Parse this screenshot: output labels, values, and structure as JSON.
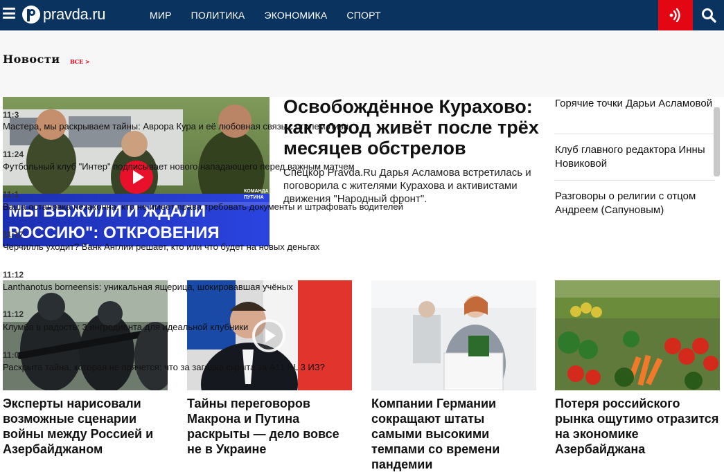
{
  "header": {
    "logo_text": "pravda.ru",
    "nav": [
      "МИР",
      "ПОЛИТИКА",
      "ЭКОНОМИКА",
      "СПОРТ"
    ],
    "colors": {
      "bar": "#0b3360",
      "accent": "#e30613"
    }
  },
  "news_section": {
    "title": "Новости",
    "all_link": "ВСЕ >"
  },
  "feature": {
    "image_caption": "МЫ ВЫЖИЛИ И ЖДАЛИ РОССИЮ\": ОТКРОВЕНИЯ ЖИТЕЛЕЙ КУРАХОВО",
    "image_badge": "КОМАНДА ПУТИНА",
    "title": "Освобождённое Курахово: как город живёт после трёх месяцев обстрелов",
    "lead": "Спецкор Pravda.Ru Дарья Асламова встретилась и поговорила с жителями Курахова и активистами движения \"Народный фронт\"."
  },
  "right_list": [
    "Горячие точки Дарьи Асламовой",
    "Клуб главного редактора Инны Новиковой",
    "Разговоры о религии с отцом Андреем (Сапуновым)"
  ],
  "feed": [
    {
      "time": "11:3",
      "text": "Мастера, мы раскрываем тайны: Аврора Кура и её любовная связь с стилем Ливи"
    },
    {
      "time": "11:24",
      "text": "Футбольный клуб \"Интер\" подписывает нового нападающего перед важным матчем"
    },
    {
      "time": "11:1",
      "text": "Ваша остановка незаконна, кто не имеет права требовать документы и штрафовать водителей"
    },
    {
      "time": "11:17",
      "text": "Черчилль уходит? Банк Англии решает, кто или что будет на новых деньгах"
    },
    {
      "time": "11:12",
      "text": "Lanthanotus borneensis: уникальная ящерица, шокировавшая учёных"
    },
    {
      "time": "11:12",
      "text": "Клумба в радость: 3 ингредиента для идеальной клубники"
    },
    {
      "time": "11:0",
      "text": "Раскрыта тайна, которая не прячется: что за загадка скрыта за A11 PL 3 ИЗ?"
    }
  ],
  "cards": [
    {
      "title": "Эксперты нарисовали возможные сценарии войны между Россией и Азербайджаном"
    },
    {
      "title": "Тайны переговоров Макрона и Путина раскрыты — дело вовсе не в Украине"
    },
    {
      "title": "Компании Германии сокращают штаты самыми высокими темпами со времени пандемии"
    },
    {
      "title": "Потеря российского рынка ощутимо отразится на экономике Азербайджана"
    }
  ]
}
